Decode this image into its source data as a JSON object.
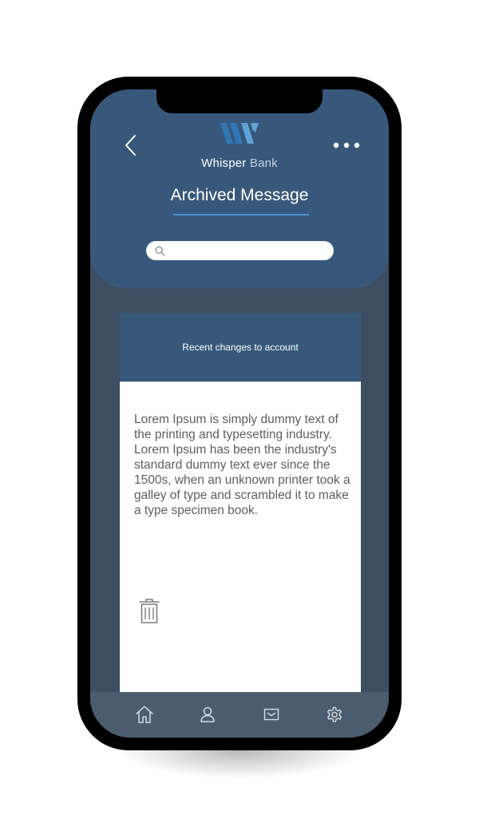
{
  "brand": {
    "name": "Whisper",
    "suffix": "Bank"
  },
  "header": {
    "title": "Archived Message",
    "back_icon": "chevron-left-icon",
    "more_icon": "more-horizontal-icon"
  },
  "search": {
    "placeholder": "",
    "icon": "search-icon"
  },
  "message": {
    "subject": "Recent changes to account",
    "body": "Lorem Ipsum is simply dummy text of the printing and typesetting industry. Lorem Ipsum has been the industry's standard dummy text ever since the 1500s, when an unknown printer took a galley of type and scrambled it to make a type specimen book.",
    "delete_icon": "trash-icon"
  },
  "tabbar": {
    "items": [
      {
        "icon": "home-icon"
      },
      {
        "icon": "user-icon"
      },
      {
        "icon": "mail-icon"
      },
      {
        "icon": "gear-icon"
      }
    ]
  },
  "colors": {
    "header": "#38587b",
    "screen_background": "#3d4e61",
    "accent": "#4a94cf",
    "tabbar": "#4b5c6e",
    "card": "#ffffff"
  }
}
